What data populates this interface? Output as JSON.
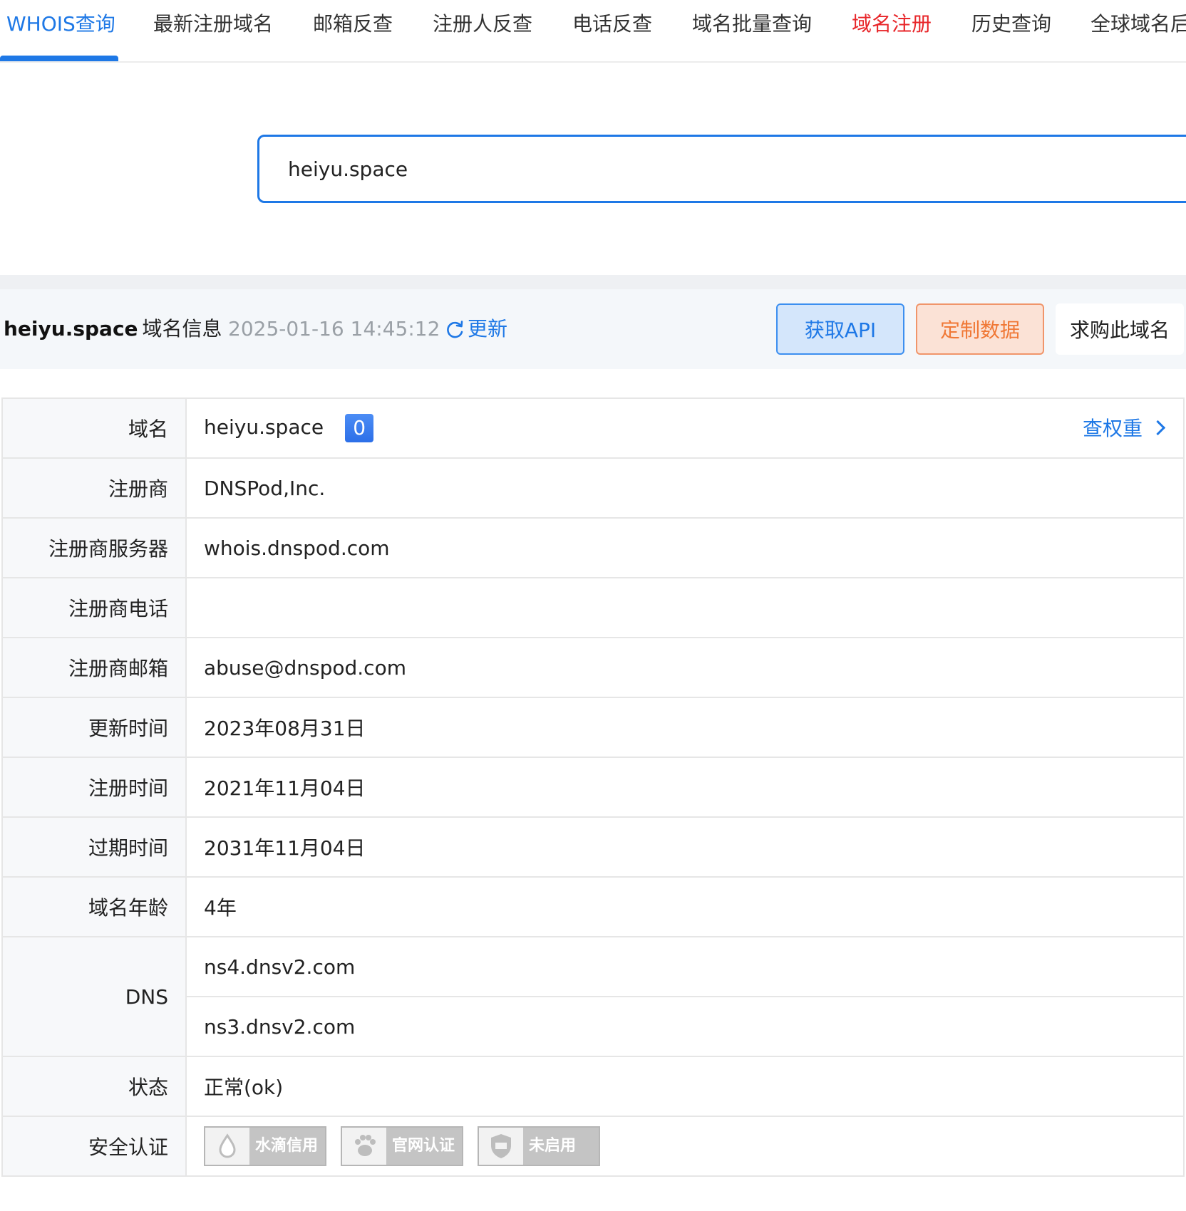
{
  "nav": {
    "items": [
      {
        "label": "WHOIS查询"
      },
      {
        "label": "最新注册域名"
      },
      {
        "label": "邮箱反查"
      },
      {
        "label": "注册人反查"
      },
      {
        "label": "电话反查"
      },
      {
        "label": "域名批量查询"
      },
      {
        "label": "域名注册"
      },
      {
        "label": "历史查询"
      },
      {
        "label": "全球域名后缀"
      }
    ],
    "active_color": "#1e78e6",
    "hot_color": "#e8262a"
  },
  "search": {
    "value": "heiyu.space"
  },
  "info": {
    "domain": "heiyu.space",
    "suffix": "域名信息",
    "timestamp": "2025-01-16 14:45:12",
    "refresh_label": "更新",
    "buttons": {
      "api": "获取API",
      "custom": "定制数据",
      "buy": "求购此域名"
    }
  },
  "table": {
    "rows": [
      {
        "label": "域名",
        "value": "heiyu.space",
        "badge": "0",
        "link": "查权重"
      },
      {
        "label": "注册商",
        "value": "DNSPod,Inc."
      },
      {
        "label": "注册商服务器",
        "value": "whois.dnspod.com"
      },
      {
        "label": "注册商电话",
        "value": ""
      },
      {
        "label": "注册商邮箱",
        "value": "abuse@dnspod.com"
      },
      {
        "label": "更新时间",
        "value": "2023年08月31日"
      },
      {
        "label": "注册时间",
        "value": "2021年11月04日"
      },
      {
        "label": "过期时间",
        "value": "2031年11月04日"
      },
      {
        "label": "域名年龄",
        "value": "4年"
      }
    ],
    "dns": {
      "label": "DNS",
      "values": [
        "ns4.dnsv2.com",
        "ns3.dnsv2.com"
      ]
    },
    "status": {
      "label": "状态",
      "value": "正常(ok)"
    },
    "security": {
      "label": "安全认证",
      "certs": [
        {
          "icon": "water-drop-icon",
          "text": "水滴信用"
        },
        {
          "icon": "paw-icon",
          "text": "官网认证"
        },
        {
          "icon": "ssl-shield-icon",
          "text": "未启用"
        }
      ]
    }
  }
}
